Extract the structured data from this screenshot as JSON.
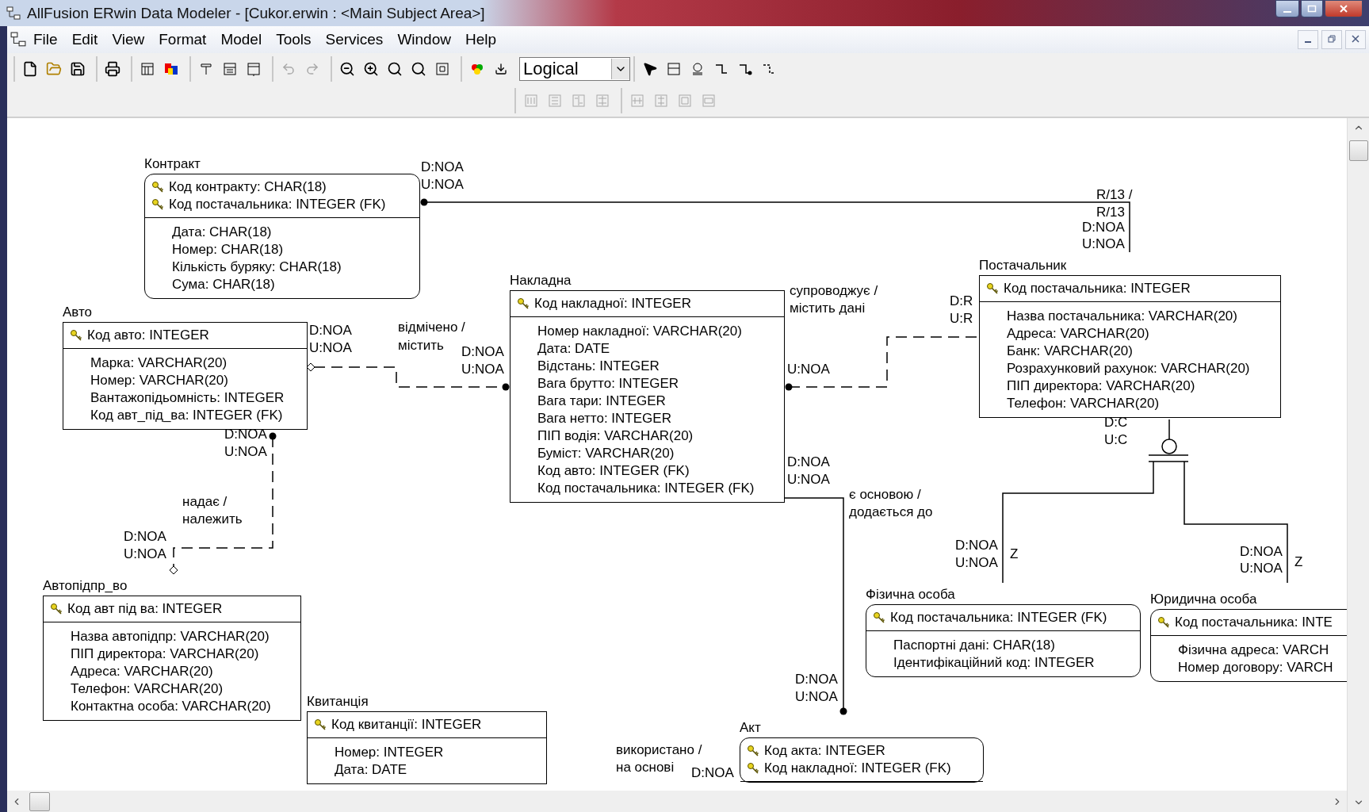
{
  "window": {
    "title": "AllFusion ERwin Data Modeler - [Cukor.erwin : <Main Subject Area>]"
  },
  "menu": [
    {
      "label": "File"
    },
    {
      "label": "Edit"
    },
    {
      "label": "View"
    },
    {
      "label": "Format"
    },
    {
      "label": "Model"
    },
    {
      "label": "Tools"
    },
    {
      "label": "Services"
    },
    {
      "label": "Window"
    },
    {
      "label": "Help"
    }
  ],
  "toolbar": {
    "view_dropdown": {
      "value": "Logical"
    }
  },
  "diagram": {
    "entities": [
      {
        "name": "Контракт",
        "kind": "dependent",
        "keys": [
          "Код контракту: CHAR(18)",
          "Код постачальника: INTEGER (FK)"
        ],
        "attributes": [
          "Дата: CHAR(18)",
          "Номер: CHAR(18)",
          "Кількість буряку: CHAR(18)",
          "Сума: CHAR(18)"
        ]
      },
      {
        "name": "Авто",
        "kind": "independent",
        "keys": [
          "Код авто: INTEGER"
        ],
        "attributes": [
          "Марка: VARCHAR(20)",
          "Номер: VARCHAR(20)",
          "Вантажопідьомність: INTEGER",
          "Код авт_під_ва: INTEGER (FK)"
        ]
      },
      {
        "name": "Накладна",
        "kind": "independent",
        "keys": [
          "Код накладної: INTEGER"
        ],
        "attributes": [
          "Номер накладної: VARCHAR(20)",
          "Дата: DATE",
          "Відстань: INTEGER",
          "Вага брутто: INTEGER",
          "Вага тари: INTEGER",
          "Вага нетто: INTEGER",
          "ПІП водія: VARCHAR(20)",
          "Буміст: VARCHAR(20)",
          "Код авто: INTEGER (FK)",
          "Код постачальника: INTEGER (FK)"
        ]
      },
      {
        "name": "Постачальник",
        "kind": "independent",
        "keys": [
          "Код постачальника: INTEGER"
        ],
        "attributes": [
          "Назва постачальника: VARCHAR(20)",
          "Адреса: VARCHAR(20)",
          "Банк: VARCHAR(20)",
          "Розрахунковий рахунок: VARCHAR(20)",
          "ПІП директора: VARCHAR(20)",
          "Телефон: VARCHAR(20)"
        ]
      },
      {
        "name": "Автопідпр_во",
        "kind": "independent",
        "keys": [
          "Код авт  під  ва: INTEGER"
        ],
        "attributes": [
          "Назва автопідпр: VARCHAR(20)",
          "ПІП директора: VARCHAR(20)",
          "Адреса: VARCHAR(20)",
          "Телефон: VARCHAR(20)",
          "Контактна особа: VARCHAR(20)"
        ]
      },
      {
        "name": "Квитанція",
        "kind": "independent",
        "keys": [
          "Код квитанції: INTEGER"
        ],
        "attributes": [
          "Номер: INTEGER",
          "Дата: DATE"
        ]
      },
      {
        "name": "Фізична особа",
        "kind": "dependent",
        "keys": [
          "Код постачальника: INTEGER (FK)"
        ],
        "attributes": [
          "Паспортні дані: CHAR(18)",
          "Ідентифікаційний код: INTEGER"
        ]
      },
      {
        "name": "Юридична особа",
        "kind": "dependent",
        "keys": [
          "Код постачальника: INTE"
        ],
        "attributes": [
          "Фізична адреса: VARCH",
          "Номер договору: VARCH"
        ]
      },
      {
        "name": "Акт",
        "kind": "dependent",
        "keys": [
          "Код акта: INTEGER",
          "Код накладної: INTEGER (FK)"
        ]
      }
    ],
    "labels": [
      {
        "text": "D:NOA"
      },
      {
        "text": "U:NOA"
      },
      {
        "text": "R/13 /"
      },
      {
        "text": "R/13"
      },
      {
        "text": "D:NOA"
      },
      {
        "text": "U:NOA"
      },
      {
        "text": "D:R"
      },
      {
        "text": "U:R"
      },
      {
        "text": "супроводжує /"
      },
      {
        "text": "містить дані"
      },
      {
        "text": "D:NOA"
      },
      {
        "text": "U:NOA"
      },
      {
        "text": "відмічено /"
      },
      {
        "text": "містить"
      },
      {
        "text": "D:NOA"
      },
      {
        "text": "U:NOA"
      },
      {
        "text": "U:NOA"
      },
      {
        "text": "D:C"
      },
      {
        "text": "U:C"
      },
      {
        "text": "D:NOA"
      },
      {
        "text": "U:NOA"
      },
      {
        "text": "D:NOA"
      },
      {
        "text": "U:NOA"
      },
      {
        "text": "є основою /"
      },
      {
        "text": "додається до"
      },
      {
        "text": "надає /"
      },
      {
        "text": "належить"
      },
      {
        "text": "D:NOA"
      },
      {
        "text": "U:NOA"
      },
      {
        "text": "Z"
      },
      {
        "text": "D:NOA"
      },
      {
        "text": "U:NOA"
      },
      {
        "text": "Z"
      },
      {
        "text": "D:NOA"
      },
      {
        "text": "U:NOA"
      },
      {
        "text": "D:NOA"
      },
      {
        "text": "U:NOA"
      },
      {
        "text": "використано /"
      },
      {
        "text": "на основі"
      },
      {
        "text": "D:NOA"
      }
    ]
  }
}
